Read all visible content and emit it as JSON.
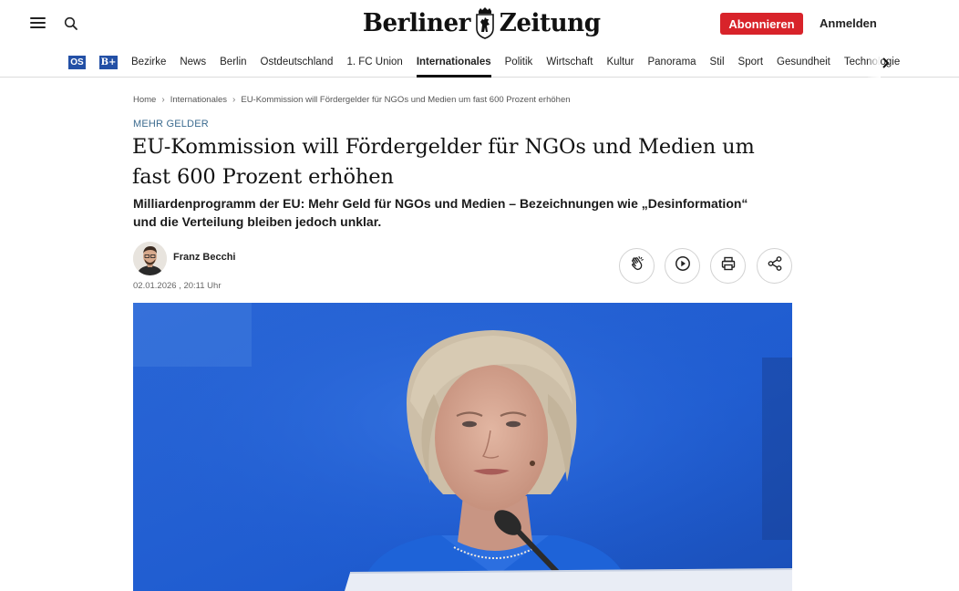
{
  "header": {
    "logo_text_left": "Berliner",
    "logo_text_right": "Zeitung",
    "subscribe_label": "Abonnieren",
    "login_label": "Anmelden"
  },
  "nav": {
    "badge_os": "OS",
    "badge_bz": "B+",
    "items": [
      "Bezirke",
      "News",
      "Berlin",
      "Ostdeutschland",
      "1. FC Union",
      "Internationales",
      "Politik",
      "Wirtschaft",
      "Kultur",
      "Panorama",
      "Stil",
      "Sport",
      "Gesundheit",
      "Technologie"
    ],
    "active": "Internationales"
  },
  "breadcrumb": [
    "Home",
    "Internationales",
    "EU-Kommission will Fördergelder für NGOs und Medien um fast 600 Prozent erhöhen"
  ],
  "article": {
    "kicker": "MEHR GELDER",
    "headline": "EU-Kommission will Fördergelder für NGOs und Medien um fast 600 Prozent erhöhen",
    "lead": "Milliardenprogramm der EU: Mehr Geld für NGOs und Medien – Bezeichnungen wie „Desinformation“ und die Verteilung bleiben jedoch unklar.",
    "author": "Franz Becchi",
    "date": "02.01.2026 , 20:11 Uhr"
  },
  "actions": [
    "clap-icon",
    "play-icon",
    "print-icon",
    "share-icon"
  ],
  "colors": {
    "subscribe_bg": "#d8232a",
    "badge_blue": "#2350a6",
    "kicker": "#3c6b8f",
    "hero_blue": "#1f5fcf"
  }
}
